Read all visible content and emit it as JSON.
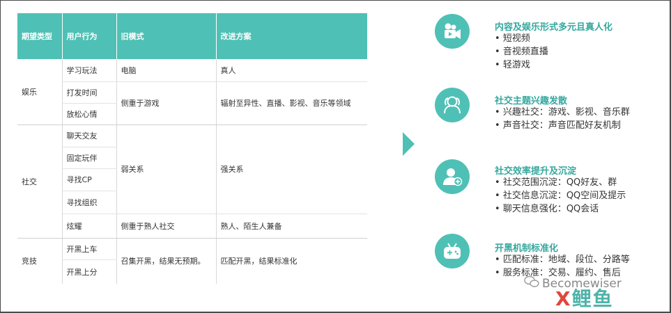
{
  "table": {
    "headers": [
      "期望类型",
      "用户行为",
      "旧模式",
      "改进方案"
    ],
    "entertainment": {
      "type": "娱乐",
      "behaviors": [
        "学习玩法",
        "打发时间",
        "放松心情"
      ],
      "old_1": "电脑",
      "new_1": "真人",
      "old_2": "侧重于游戏",
      "new_2": "辐射至异性、直播、影视、音乐等领域"
    },
    "social": {
      "type": "社交",
      "behaviors": [
        "聊天交友",
        "固定玩伴",
        "寻找CP",
        "寻找组织",
        "炫耀"
      ],
      "old_1": "弱关系",
      "new_1": "强关系",
      "old_2": "侧重于熟人社交",
      "new_2": "熟人、陌生人兼备"
    },
    "competitive": {
      "type": "竞技",
      "behaviors": [
        "开黑上车",
        "开黑上分"
      ],
      "old": "召集开黑，结果无预期。",
      "new": "匹配开黑，结果标准化"
    }
  },
  "cards": [
    {
      "title": "内容及娱乐形式多元且真人化",
      "icon": "video-camera-icon",
      "items": [
        "短视频",
        "音视频直播",
        "轻游戏"
      ]
    },
    {
      "title": "社交主题兴趣发散",
      "icon": "users-icon",
      "items": [
        "兴趣社交：游戏、影视、音乐群",
        "声音社交：声音匹配好友机制"
      ]
    },
    {
      "title": "社交效率提升及沉淀",
      "icon": "add-user-icon",
      "items": [
        "社交范围沉淀：QQ好友、群",
        "社交信息沉淀：QQ空间及提示",
        "聊天信息强化：QQ会话"
      ]
    },
    {
      "title": "开黑机制标准化",
      "icon": "gamepad-icon",
      "items": [
        "匹配标准：地域、段位、分路等",
        "服务标准：交易、履约、售后"
      ]
    }
  ],
  "colors": {
    "accent": "#4fc0b5",
    "title_teal": "#35a89d"
  },
  "watermark": {
    "account": "Becomewiser",
    "brand_x": "X",
    "brand_rest": "鲤鱼"
  }
}
